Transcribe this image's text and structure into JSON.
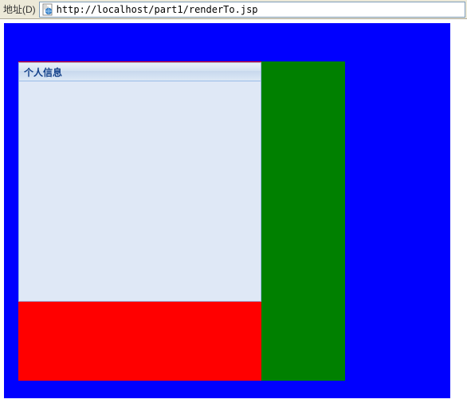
{
  "addressBar": {
    "label": "地址(D)",
    "url": "http://localhost/part1/renderTo.jsp"
  },
  "panel": {
    "title": "个人信息"
  },
  "colors": {
    "blue": "#0000ff",
    "red": "#ff0000",
    "green": "#008000",
    "extBorder": "#99bbe8",
    "extBody": "#dfe8f6",
    "extTitleColor": "#15428b"
  }
}
